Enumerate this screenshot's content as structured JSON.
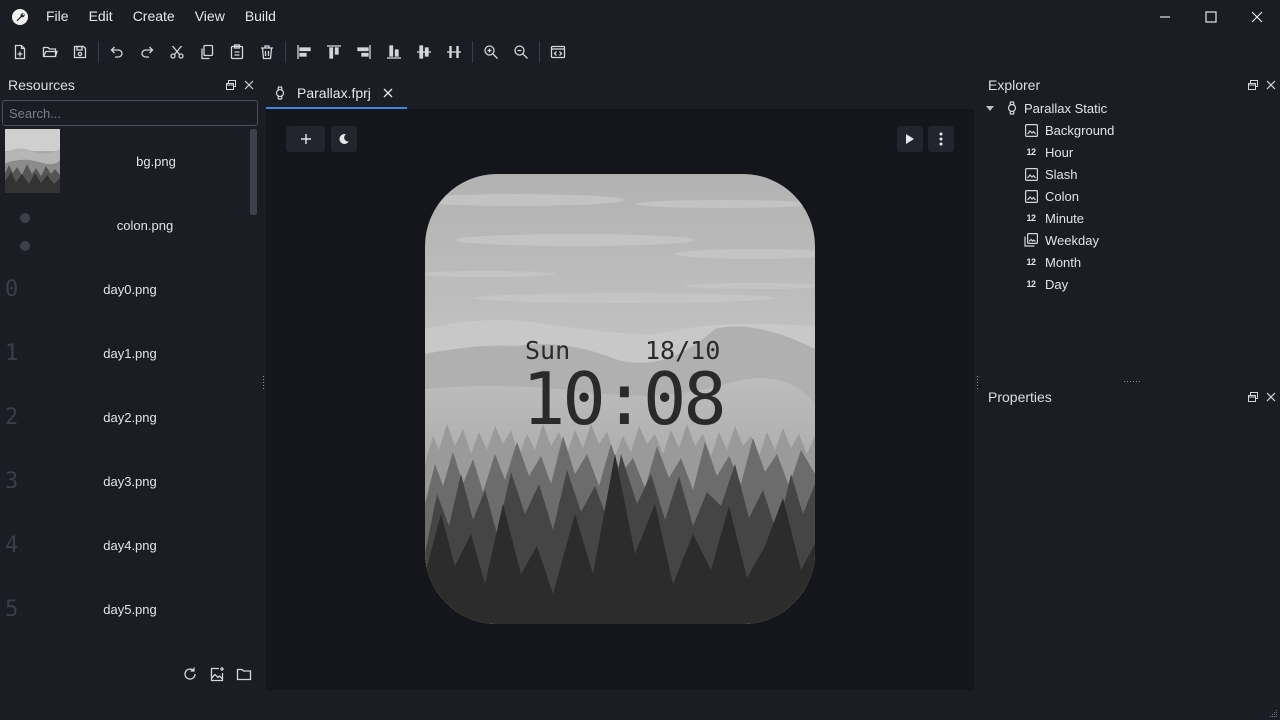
{
  "menubar": {
    "app_icon": "wrench-logo-icon",
    "items": [
      "File",
      "Edit",
      "Create",
      "View",
      "Build"
    ]
  },
  "toolbar": {
    "buttons": [
      "new-file-icon",
      "open-folder-icon",
      "save-icon",
      "undo-icon",
      "redo-icon",
      "cut-icon",
      "copy-icon",
      "paste-icon",
      "delete-icon",
      "align-left-icon",
      "align-top-icon",
      "align-right-icon",
      "align-bottom-icon",
      "align-center-v-icon",
      "align-center-h-icon",
      "zoom-in-icon",
      "zoom-out-icon",
      "code-view-icon"
    ]
  },
  "resources": {
    "title": "Resources",
    "search_placeholder": "Search...",
    "items": [
      {
        "name": "bg.png",
        "preview": "landscape"
      },
      {
        "name": "colon.png",
        "preview": "colon"
      },
      {
        "name": "day0.png",
        "preview": "0"
      },
      {
        "name": "day1.png",
        "preview": "1"
      },
      {
        "name": "day2.png",
        "preview": "2"
      },
      {
        "name": "day3.png",
        "preview": "3"
      },
      {
        "name": "day4.png",
        "preview": "4"
      },
      {
        "name": "day5.png",
        "preview": "5"
      }
    ]
  },
  "editor": {
    "tab": {
      "label": "Parallax.fprj"
    }
  },
  "watchface": {
    "weekday": "Sun",
    "date": "18/10",
    "time": "10:08"
  },
  "explorer": {
    "title": "Explorer",
    "root": "Parallax Static",
    "children": [
      {
        "label": "Background",
        "icon": "image-icon"
      },
      {
        "label": "Hour",
        "icon": "number-icon"
      },
      {
        "label": "Slash",
        "icon": "image-icon"
      },
      {
        "label": "Colon",
        "icon": "image-icon"
      },
      {
        "label": "Minute",
        "icon": "number-icon"
      },
      {
        "label": "Weekday",
        "icon": "image-list-icon"
      },
      {
        "label": "Month",
        "icon": "number-icon"
      },
      {
        "label": "Day",
        "icon": "number-icon"
      }
    ]
  },
  "properties": {
    "title": "Properties"
  },
  "number_icon_text": "12",
  "colors": {
    "background": "#1b1d25",
    "canvas": "#14161c",
    "accent": "#3c86e0"
  }
}
